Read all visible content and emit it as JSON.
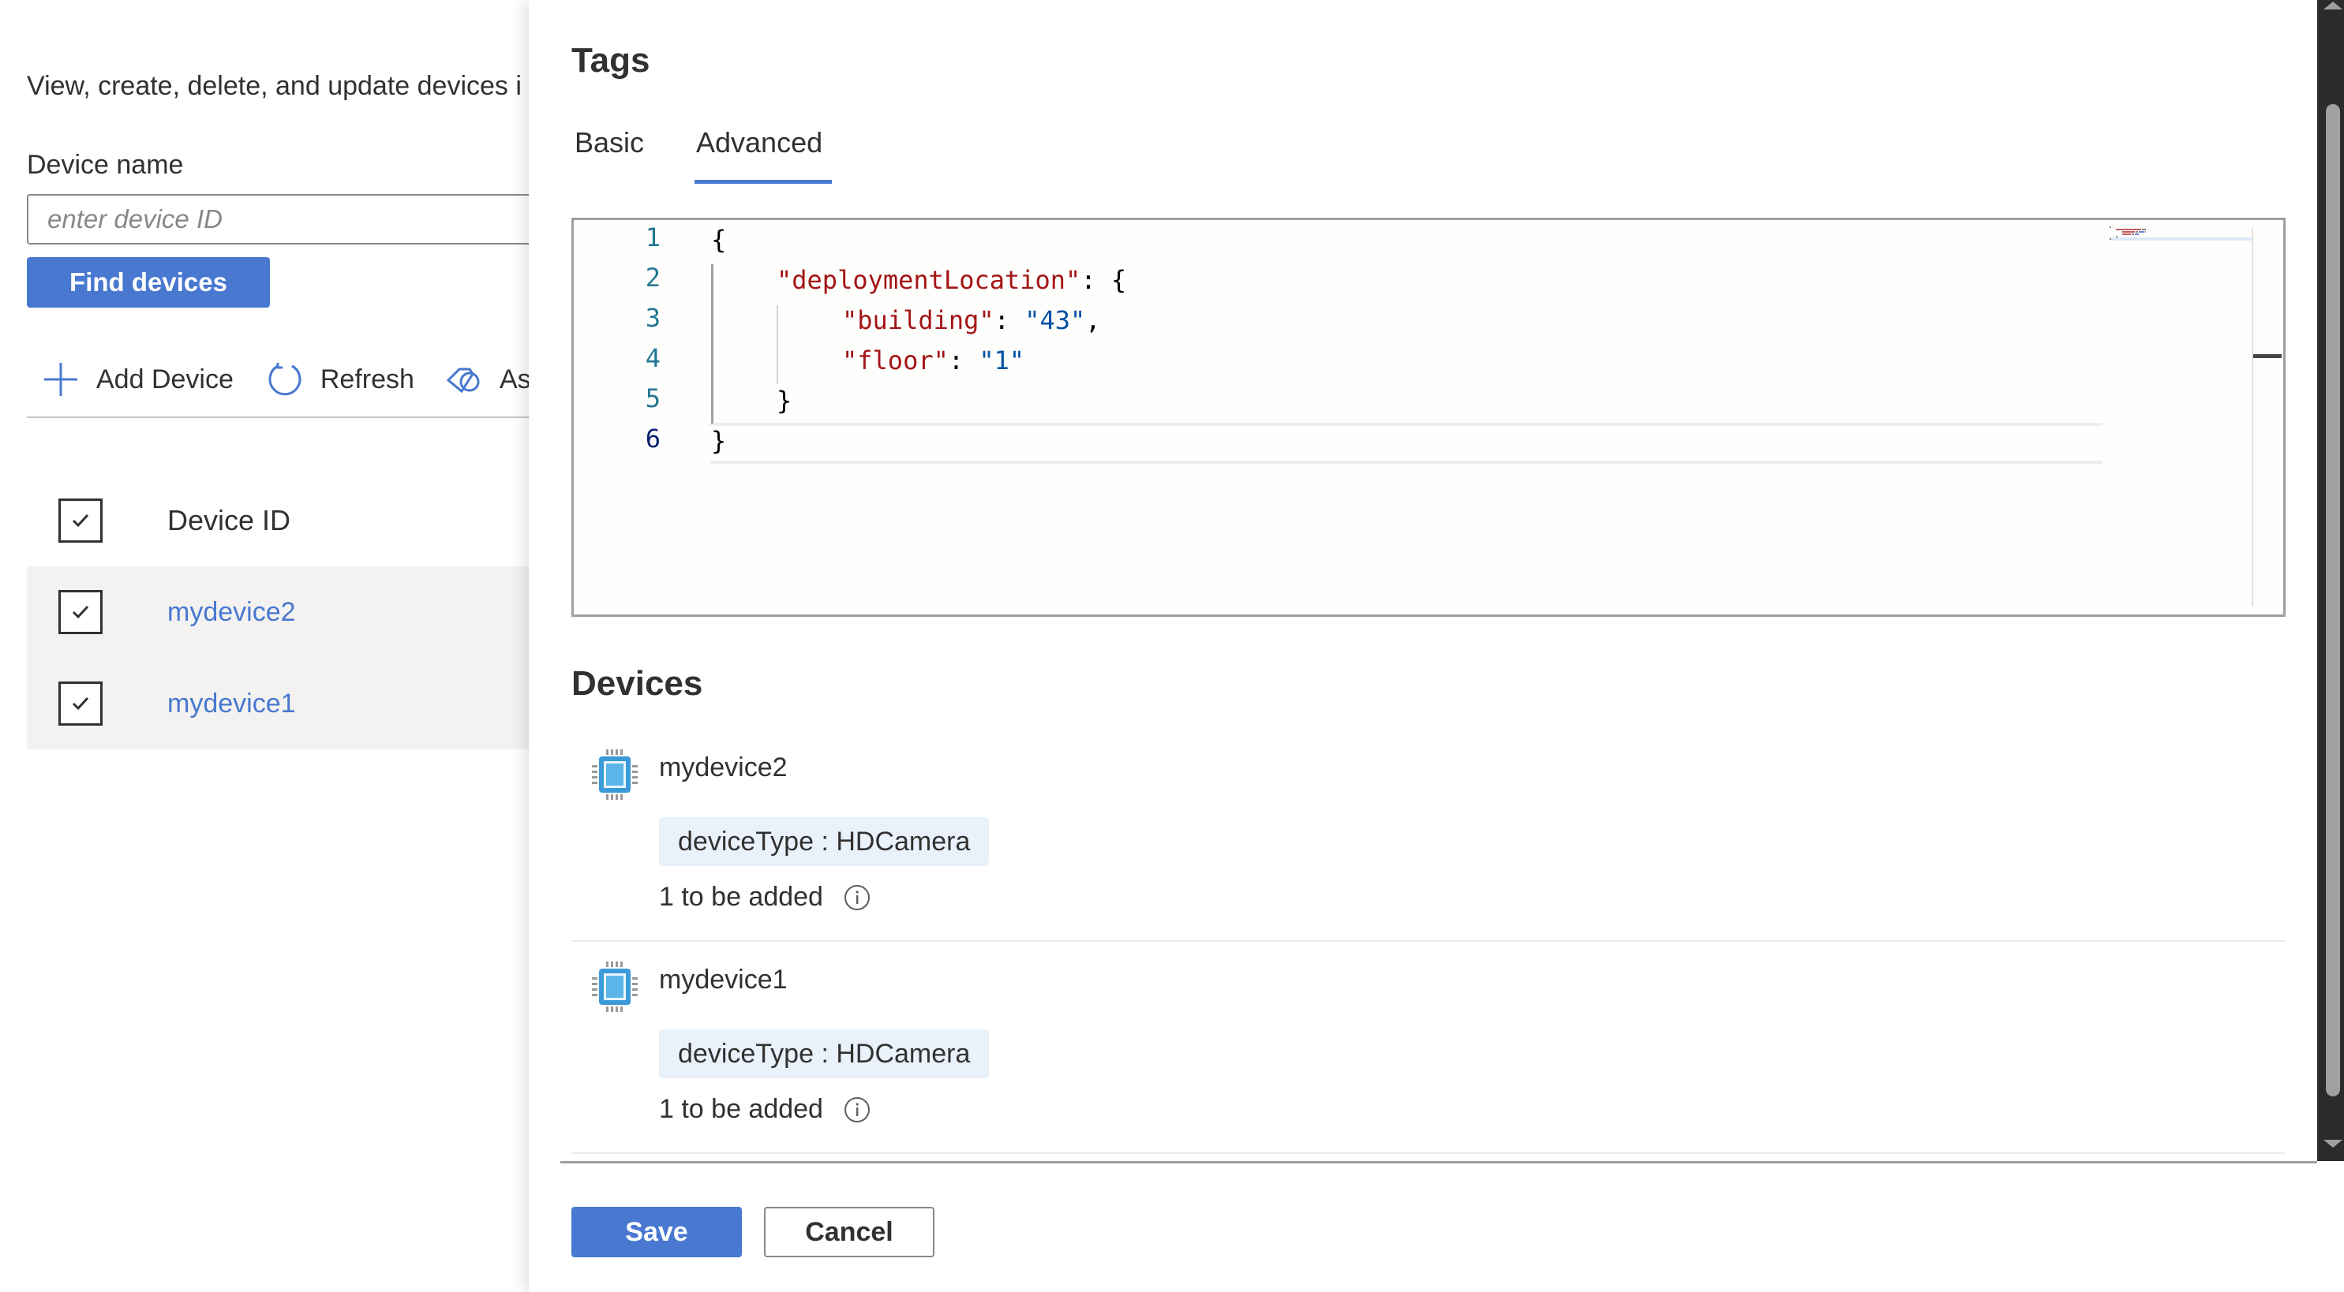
{
  "background": {
    "description": "View, create, delete, and update devices i",
    "device_name_label": "Device name",
    "device_id_input": {
      "value": "",
      "placeholder": "enter device ID"
    },
    "find_button": "Find devices",
    "toolbar": {
      "add_device": "Add Device",
      "refresh": "Refresh",
      "assign_tags": "As"
    },
    "table": {
      "header": "Device ID",
      "rows": [
        {
          "device_id": "mydevice2",
          "checked": true
        },
        {
          "device_id": "mydevice1",
          "checked": true
        }
      ]
    }
  },
  "panel": {
    "title": "Tags",
    "tabs": [
      {
        "label": "Basic",
        "active": false
      },
      {
        "label": "Advanced",
        "active": true
      }
    ],
    "editor": {
      "line_numbers": [
        "1",
        "2",
        "3",
        "4",
        "5",
        "6"
      ],
      "active_line": 6,
      "lines": [
        {
          "indent": 0,
          "tokens": [
            {
              "t": "p",
              "s": "{"
            }
          ]
        },
        {
          "indent": 1,
          "tokens": [
            {
              "t": "k",
              "s": "\"deploymentLocation\""
            },
            {
              "t": "p",
              "s": ": {"
            }
          ]
        },
        {
          "indent": 2,
          "tokens": [
            {
              "t": "k",
              "s": "\"building\""
            },
            {
              "t": "p",
              "s": ": "
            },
            {
              "t": "v",
              "s": "\"43\""
            },
            {
              "t": "p",
              "s": ","
            }
          ]
        },
        {
          "indent": 2,
          "tokens": [
            {
              "t": "k",
              "s": "\"floor\""
            },
            {
              "t": "p",
              "s": ": "
            },
            {
              "t": "v",
              "s": "\"1\""
            }
          ]
        },
        {
          "indent": 1,
          "tokens": [
            {
              "t": "p",
              "s": "}"
            }
          ]
        },
        {
          "indent": 0,
          "tokens": [
            {
              "t": "p",
              "s": "}"
            }
          ]
        }
      ]
    },
    "devices_title": "Devices",
    "devices": [
      {
        "name": "mydevice2",
        "tag": "deviceType : HDCamera",
        "pending": "1 to be added"
      },
      {
        "name": "mydevice1",
        "tag": "deviceType : HDCamera",
        "pending": "1 to be added"
      }
    ],
    "save_button": "Save",
    "cancel_button": "Cancel"
  },
  "colors": {
    "accent": "#4878cf",
    "json_key": "#a31515",
    "json_value": "#0451a5",
    "line_number": "#237893",
    "chip_bg": "#e9f1fb",
    "row_bg": "#f3f2f1"
  }
}
